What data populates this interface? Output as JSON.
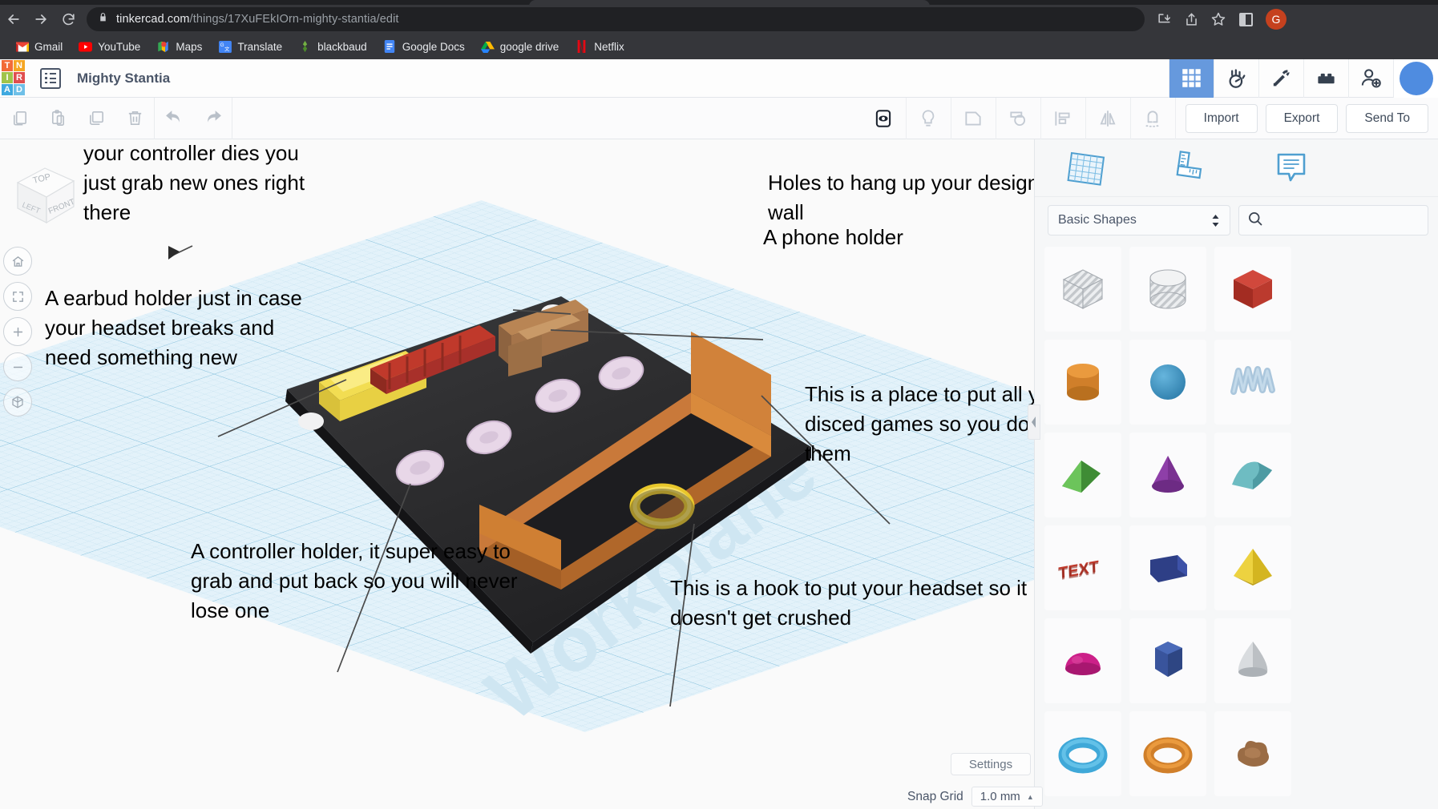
{
  "browser": {
    "url_domain": "tinkercad.com",
    "url_path": "/things/17XuFEkIOrn-mighty-stantia/edit",
    "lock_icon": "lock-icon",
    "back_icon": "back-arrow-icon",
    "forward_icon": "forward-arrow-icon",
    "reload_icon": "reload-icon",
    "install_icon": "install-app-icon",
    "share_icon": "share-icon",
    "bookmark_icon": "star-icon",
    "sidepanel_icon": "side-panel-icon",
    "profile_initial": "G",
    "bookmarks": [
      {
        "label": "Gmail",
        "icon": "gmail-icon"
      },
      {
        "label": "YouTube",
        "icon": "youtube-icon"
      },
      {
        "label": "Maps",
        "icon": "maps-icon"
      },
      {
        "label": "Translate",
        "icon": "translate-icon"
      },
      {
        "label": "blackbaud",
        "icon": "blackbaud-icon"
      },
      {
        "label": "Google Docs",
        "icon": "google-docs-icon"
      },
      {
        "label": "google drive",
        "icon": "google-drive-icon"
      },
      {
        "label": "Netflix",
        "icon": "netflix-icon"
      }
    ]
  },
  "app_header": {
    "logo_letters": [
      "T",
      "N",
      "I",
      "R",
      "A",
      "D"
    ],
    "logo_colors": [
      "#f26b38",
      "#f5a623",
      "#a0c44a",
      "#e04e4e",
      "#3fa9e0",
      "#6fc0e8"
    ],
    "design_title": "Mighty Stantia",
    "menu_icon": "design-list-icon",
    "tools": [
      {
        "name": "grid-view-button",
        "icon": "grid-icon",
        "active": true
      },
      {
        "name": "blocks-button",
        "icon": "hand-blocks-icon",
        "active": false
      },
      {
        "name": "minecraft-button",
        "icon": "pickaxe-icon",
        "active": false
      },
      {
        "name": "bricks-button",
        "icon": "lego-brick-icon",
        "active": false
      },
      {
        "name": "invite-button",
        "icon": "add-person-icon",
        "active": false
      }
    ]
  },
  "toolbar": {
    "left_icons": [
      "copy-icon",
      "paste-icon",
      "duplicate-icon",
      "delete-icon",
      "undo-icon",
      "redo-icon"
    ],
    "mid_icons": [
      "show-hide-icon",
      "light-bulb-icon",
      "group-icon",
      "ungroup-icon",
      "align-icon",
      "mirror-icon",
      "magnet-icon"
    ],
    "import_label": "Import",
    "export_label": "Export",
    "send_to_label": "Send To"
  },
  "canvas": {
    "view_cube": {
      "top": "TOP",
      "left": "LEFT",
      "front": "FRONT"
    },
    "nav_buttons": [
      {
        "name": "home-view-button",
        "icon": "home-icon"
      },
      {
        "name": "fit-view-button",
        "icon": "fit-frame-icon"
      },
      {
        "name": "zoom-in-button",
        "icon": "plus-icon"
      },
      {
        "name": "zoom-out-button",
        "icon": "minus-icon"
      },
      {
        "name": "ortho-perspective-button",
        "icon": "cube-view-icon"
      }
    ],
    "workplane_watermark": "Workplane",
    "annotations": [
      {
        "id": "battery-holder",
        "text": "Battery holder so when\nyour controller dies you\njust grab new ones right\nthere"
      },
      {
        "id": "holes-hang",
        "text": "Holes to hang up your design on the\nwall"
      },
      {
        "id": "phone-holder",
        "text": "A phone holder"
      },
      {
        "id": "earbud-holder",
        "text": "A earbud holder just in case\nyour headset breaks and\nneed something new"
      },
      {
        "id": "disc-games",
        "text": "This is a place to put all your\ndisced games so you dont lose\nthem"
      },
      {
        "id": "controller-holder",
        "text": "A controller holder, it super easy to\ngrab and put back so you will never\nlose one"
      },
      {
        "id": "headset-hook",
        "text": "This is a hook to put your headset so it\ndoesn't get crushed"
      }
    ]
  },
  "right_panel": {
    "tabs": [
      {
        "name": "workplane-tab",
        "icon": "workplane-grid-icon"
      },
      {
        "name": "ruler-tab",
        "icon": "ruler-icon"
      },
      {
        "name": "notes-tab",
        "icon": "note-comment-icon"
      }
    ],
    "category_label": "Basic Shapes",
    "search_placeholder": "",
    "search_icon": "search-icon",
    "shapes": [
      {
        "name": "box-hole",
        "color": "#d0d3d6",
        "kind": "box-striped"
      },
      {
        "name": "cylinder-hole",
        "color": "#d0d3d6",
        "kind": "cyl-striped"
      },
      {
        "name": "box-red",
        "color": "#c0392b",
        "kind": "box"
      },
      {
        "name": "cylinder-orange",
        "color": "#e08a2e",
        "kind": "cyl"
      },
      {
        "name": "sphere-blue",
        "color": "#3d92c4",
        "kind": "sphere"
      },
      {
        "name": "scribble-wall",
        "color": "#aac6dc",
        "kind": "scribble"
      },
      {
        "name": "wedge-green",
        "color": "#4a9e40",
        "kind": "wedge"
      },
      {
        "name": "cone-purple",
        "color": "#8e3fa8",
        "kind": "cone"
      },
      {
        "name": "roof-teal",
        "color": "#63b4bc",
        "kind": "roof"
      },
      {
        "name": "text-red",
        "color": "#c0392b",
        "kind": "text"
      },
      {
        "name": "polygon-box-blue",
        "color": "#2e3f86",
        "kind": "polybox"
      },
      {
        "name": "pyramid-yellow",
        "color": "#e0c62f",
        "kind": "pyramid"
      },
      {
        "name": "dome-magenta",
        "color": "#cc2089",
        "kind": "dome"
      },
      {
        "name": "hex-prism-blue",
        "color": "#39549c",
        "kind": "hexprism"
      },
      {
        "name": "paraboloid-white",
        "color": "#cfd2d5",
        "kind": "parab"
      },
      {
        "name": "torus-blue",
        "color": "#3fa8d8",
        "kind": "torus"
      },
      {
        "name": "torus-orange",
        "color": "#e08a2e",
        "kind": "torus"
      },
      {
        "name": "blob-brown",
        "color": "#9a6c45",
        "kind": "blob"
      }
    ]
  },
  "footer": {
    "settings_label": "Settings",
    "snap_grid_label": "Snap Grid",
    "snap_grid_value": "1.0 mm",
    "snap_caret": "▲"
  }
}
